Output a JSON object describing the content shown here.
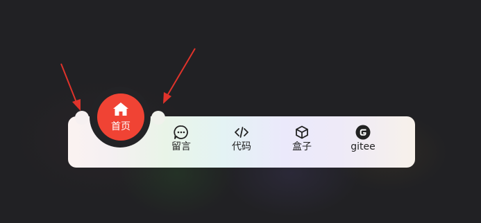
{
  "nav": {
    "active": {
      "label": "首页",
      "icon": "home-icon"
    },
    "items": [
      {
        "label": "留言",
        "icon": "chat-bubble-icon"
      },
      {
        "label": "代码",
        "icon": "code-icon"
      },
      {
        "label": "盒子",
        "icon": "box-icon"
      },
      {
        "label": "gitee",
        "icon": "gitee-icon"
      }
    ]
  },
  "colors": {
    "active": "#f04334",
    "arrow": "#e0332b",
    "background": "#212124"
  }
}
